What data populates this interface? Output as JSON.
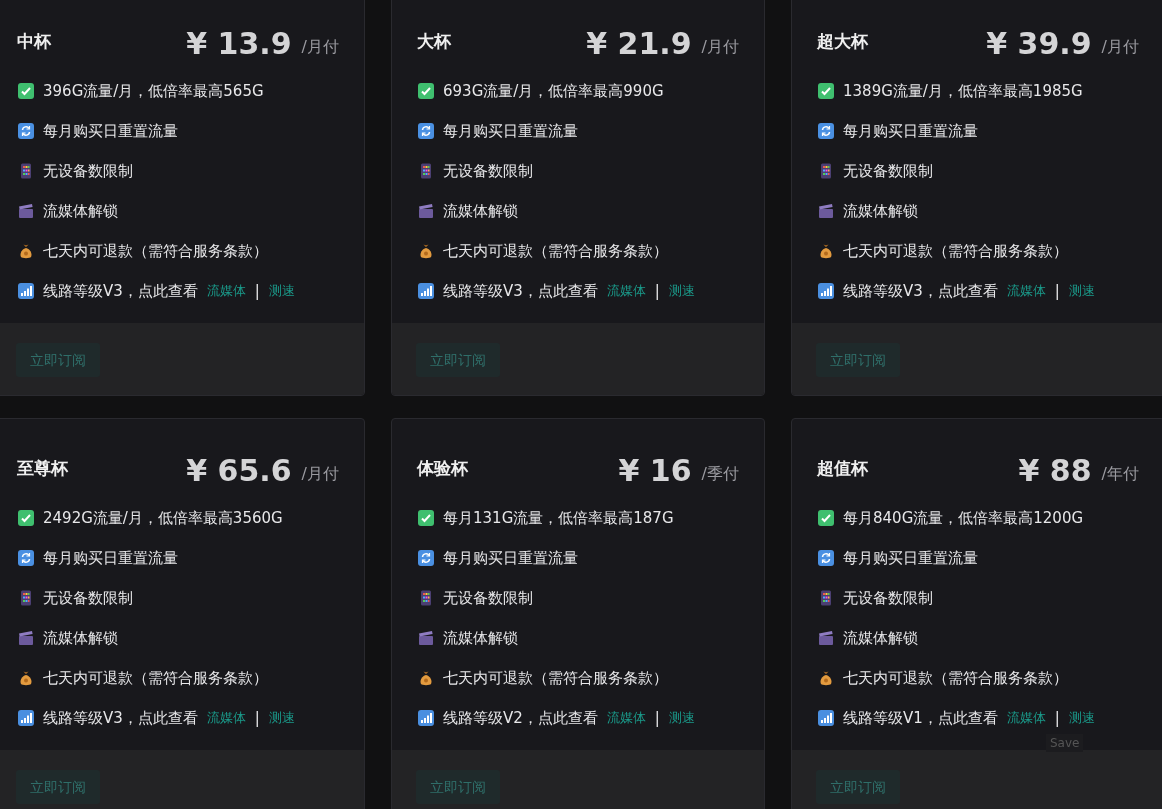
{
  "plans": [
    {
      "name": "中杯",
      "price": "¥ 13.9",
      "period": "/月付",
      "features": [
        {
          "kind": "check",
          "text": "396G流量/月，低倍率最高565G"
        },
        {
          "kind": "reset",
          "text": "每月购买日重置流量"
        },
        {
          "kind": "device",
          "text": "无设备数限制"
        },
        {
          "kind": "media",
          "text": "流媒体解锁"
        },
        {
          "kind": "refund",
          "text": "七天内可退款（需符合服务条款）"
        },
        {
          "kind": "route",
          "text": "线路等级V3，点此查看",
          "links": [
            "流媒体",
            "测速"
          ],
          "separator": "|"
        }
      ],
      "button": "立即订阅"
    },
    {
      "name": "大杯",
      "price": "¥ 21.9",
      "period": "/月付",
      "features": [
        {
          "kind": "check",
          "text": "693G流量/月，低倍率最高990G"
        },
        {
          "kind": "reset",
          "text": "每月购买日重置流量"
        },
        {
          "kind": "device",
          "text": "无设备数限制"
        },
        {
          "kind": "media",
          "text": "流媒体解锁"
        },
        {
          "kind": "refund",
          "text": "七天内可退款（需符合服务条款）"
        },
        {
          "kind": "route",
          "text": "线路等级V3，点此查看",
          "links": [
            "流媒体",
            "测速"
          ],
          "separator": "|"
        }
      ],
      "button": "立即订阅"
    },
    {
      "name": "超大杯",
      "price": "¥ 39.9",
      "period": "/月付",
      "features": [
        {
          "kind": "check",
          "text": "1389G流量/月，低倍率最高1985G"
        },
        {
          "kind": "reset",
          "text": "每月购买日重置流量"
        },
        {
          "kind": "device",
          "text": "无设备数限制"
        },
        {
          "kind": "media",
          "text": "流媒体解锁"
        },
        {
          "kind": "refund",
          "text": "七天内可退款（需符合服务条款）"
        },
        {
          "kind": "route",
          "text": "线路等级V3，点此查看",
          "links": [
            "流媒体",
            "测速"
          ],
          "separator": "|"
        }
      ],
      "button": "立即订阅"
    },
    {
      "name": "至尊杯",
      "price": "¥ 65.6",
      "period": "/月付",
      "features": [
        {
          "kind": "check",
          "text": "2492G流量/月，低倍率最高3560G"
        },
        {
          "kind": "reset",
          "text": "每月购买日重置流量"
        },
        {
          "kind": "device",
          "text": "无设备数限制"
        },
        {
          "kind": "media",
          "text": "流媒体解锁"
        },
        {
          "kind": "refund",
          "text": "七天内可退款（需符合服务条款）"
        },
        {
          "kind": "route",
          "text": "线路等级V3，点此查看",
          "links": [
            "流媒体",
            "测速"
          ],
          "separator": "|"
        }
      ],
      "button": "立即订阅"
    },
    {
      "name": "体验杯",
      "price": "¥ 16",
      "period": "/季付",
      "features": [
        {
          "kind": "check",
          "text": "每月131G流量，低倍率最高187G"
        },
        {
          "kind": "reset",
          "text": "每月购买日重置流量"
        },
        {
          "kind": "device",
          "text": "无设备数限制"
        },
        {
          "kind": "media",
          "text": "流媒体解锁"
        },
        {
          "kind": "refund",
          "text": "七天内可退款（需符合服务条款）"
        },
        {
          "kind": "route",
          "text": "线路等级V2，点此查看",
          "links": [
            "流媒体",
            "测速"
          ],
          "separator": "|"
        }
      ],
      "button": "立即订阅"
    },
    {
      "name": "超值杯",
      "price": "¥ 88",
      "period": "/年付",
      "features": [
        {
          "kind": "check",
          "text": "每月840G流量，低倍率最高1200G"
        },
        {
          "kind": "reset",
          "text": "每月购买日重置流量"
        },
        {
          "kind": "device",
          "text": "无设备数限制"
        },
        {
          "kind": "media",
          "text": "流媒体解锁"
        },
        {
          "kind": "refund",
          "text": "七天内可退款（需符合服务条款）"
        },
        {
          "kind": "route",
          "text": "线路等级V1，点此查看",
          "links": [
            "流媒体",
            "测速"
          ],
          "separator": "|"
        }
      ],
      "button": "立即订阅"
    }
  ],
  "save_tooltip": "Save"
}
